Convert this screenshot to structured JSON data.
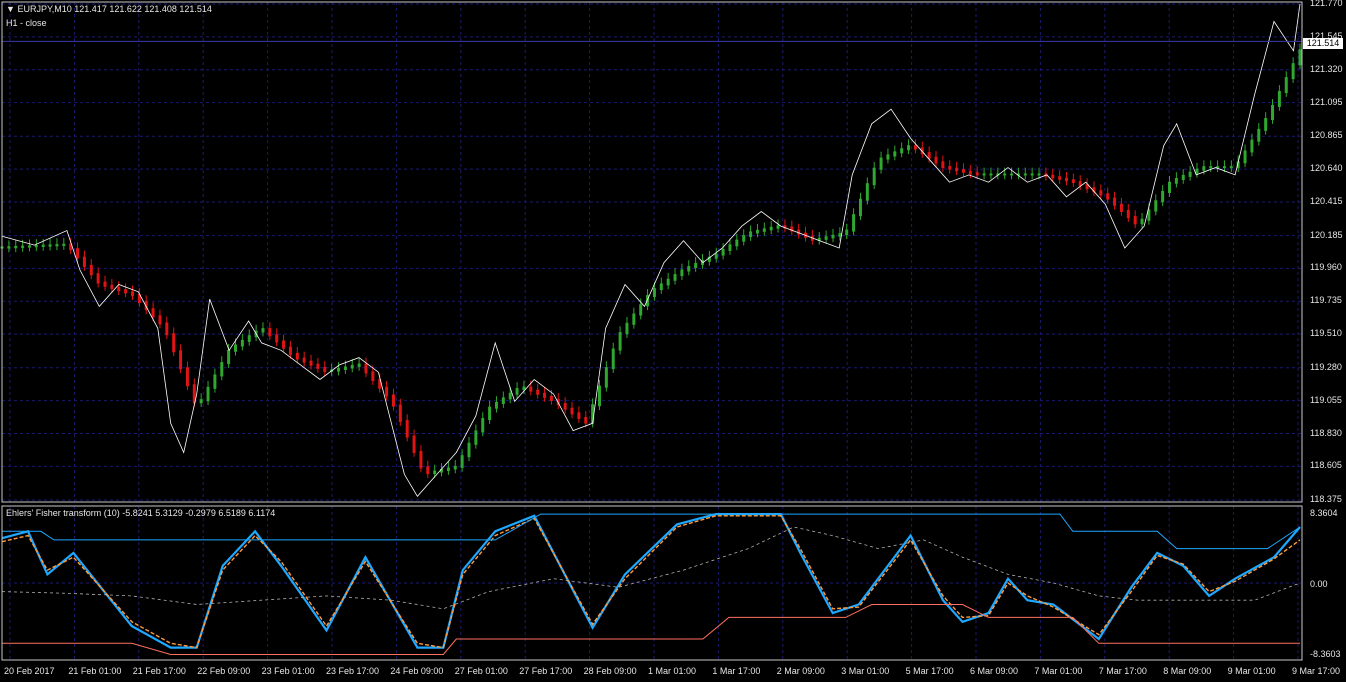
{
  "header": {
    "symbol_line": "EURJPY,M10  121.417 121.622 121.408 121.514",
    "overlay_label": "H1 - close"
  },
  "indicator": {
    "title": "Ehlers' Fisher transform (10) -5.8241 5.3129 -0.2979 6.5189 6.1174",
    "axis": {
      "top": "8.3604",
      "zero": "0.00",
      "bottom": "-8.3603"
    }
  },
  "current_price": "121.514",
  "colors": {
    "background": "#000000",
    "grid": "#1a1a6e",
    "up_bar": "#2ea82e",
    "down_bar": "#e01414",
    "close_line": "#ffffff",
    "fisher": "#1ea8ff",
    "signal": "#ff9a3c",
    "dashed": "#b0b0b0",
    "upper_band": "#1ea8ff",
    "lower_band": "#ff7060"
  },
  "chart_data": [
    {
      "type": "line",
      "title": "EURJPY,M10",
      "y_ticks": [
        "121.770",
        "121.545",
        "121.320",
        "121.095",
        "120.865",
        "120.640",
        "120.415",
        "120.185",
        "119.960",
        "119.735",
        "119.510",
        "119.280",
        "119.055",
        "118.830",
        "118.605",
        "118.375"
      ],
      "ylim": [
        118.375,
        121.77
      ],
      "x_ticks": [
        "20 Feb 2017",
        "21 Feb 01:00",
        "21 Feb 17:00",
        "22 Feb 09:00",
        "23 Feb 01:00",
        "23 Feb 17:00",
        "24 Feb 09:00",
        "27 Feb 01:00",
        "27 Feb 17:00",
        "28 Feb 09:00",
        "1 Mar 01:00",
        "1 Mar 17:00",
        "2 Mar 09:00",
        "3 Mar 01:00",
        "5 Mar 17:00",
        "6 Mar 09:00",
        "7 Mar 01:00",
        "7 Mar 17:00",
        "8 Mar 09:00",
        "9 Mar 01:00",
        "9 Mar 17:00"
      ],
      "series": [
        {
          "name": "H1 - close",
          "points": [
            [
              0,
              120.18
            ],
            [
              0.5,
              120.12
            ],
            [
              1,
              120.22
            ],
            [
              1.2,
              119.95
            ],
            [
              1.5,
              119.7
            ],
            [
              1.8,
              119.85
            ],
            [
              2.1,
              119.8
            ],
            [
              2.4,
              119.55
            ],
            [
              2.6,
              118.9
            ],
            [
              2.8,
              118.7
            ],
            [
              3.0,
              119.1
            ],
            [
              3.2,
              119.75
            ],
            [
              3.5,
              119.4
            ],
            [
              3.8,
              119.6
            ],
            [
              4.0,
              119.45
            ],
            [
              4.3,
              119.4
            ],
            [
              4.6,
              119.3
            ],
            [
              4.9,
              119.2
            ],
            [
              5.2,
              119.3
            ],
            [
              5.5,
              119.35
            ],
            [
              5.8,
              119.25
            ],
            [
              6.0,
              118.9
            ],
            [
              6.2,
              118.55
            ],
            [
              6.4,
              118.4
            ],
            [
              6.7,
              118.55
            ],
            [
              7.0,
              118.7
            ],
            [
              7.3,
              118.95
            ],
            [
              7.6,
              119.45
            ],
            [
              7.9,
              119.05
            ],
            [
              8.2,
              119.2
            ],
            [
              8.5,
              119.1
            ],
            [
              8.8,
              118.85
            ],
            [
              9.1,
              118.9
            ],
            [
              9.3,
              119.55
            ],
            [
              9.6,
              119.85
            ],
            [
              9.9,
              119.7
            ],
            [
              10.2,
              120.0
            ],
            [
              10.5,
              120.15
            ],
            [
              10.8,
              120.0
            ],
            [
              11.1,
              120.1
            ],
            [
              11.4,
              120.25
            ],
            [
              11.7,
              120.35
            ],
            [
              12.0,
              120.25
            ],
            [
              12.3,
              120.2
            ],
            [
              12.6,
              120.15
            ],
            [
              12.9,
              120.1
            ],
            [
              13.1,
              120.6
            ],
            [
              13.4,
              120.95
            ],
            [
              13.7,
              121.05
            ],
            [
              14.0,
              120.85
            ],
            [
              14.3,
              120.7
            ],
            [
              14.6,
              120.55
            ],
            [
              14.9,
              120.6
            ],
            [
              15.2,
              120.55
            ],
            [
              15.5,
              120.65
            ],
            [
              15.8,
              120.55
            ],
            [
              16.1,
              120.6
            ],
            [
              16.4,
              120.45
            ],
            [
              16.7,
              120.55
            ],
            [
              17.0,
              120.4
            ],
            [
              17.3,
              120.1
            ],
            [
              17.6,
              120.25
            ],
            [
              17.9,
              120.8
            ],
            [
              18.1,
              120.95
            ],
            [
              18.4,
              120.6
            ],
            [
              18.7,
              120.65
            ],
            [
              19.0,
              120.6
            ],
            [
              19.3,
              121.15
            ],
            [
              19.6,
              121.65
            ],
            [
              19.9,
              121.45
            ],
            [
              20.0,
              121.77
            ]
          ]
        },
        {
          "name": "",
          "points": [
            [
              0,
              120.1
            ],
            [
              1,
              120.12
            ],
            [
              1.5,
              119.85
            ],
            [
              2,
              119.78
            ],
            [
              2.5,
              119.55
            ],
            [
              3,
              119.0
            ],
            [
              3.5,
              119.4
            ],
            [
              4,
              119.55
            ],
            [
              4.5,
              119.35
            ],
            [
              5,
              119.25
            ],
            [
              5.5,
              119.3
            ],
            [
              6,
              119.05
            ],
            [
              6.5,
              118.55
            ],
            [
              7,
              118.6
            ],
            [
              7.5,
              119.0
            ],
            [
              8,
              119.15
            ],
            [
              8.5,
              119.05
            ],
            [
              9,
              118.9
            ],
            [
              9.5,
              119.5
            ],
            [
              10,
              119.8
            ],
            [
              10.5,
              119.95
            ],
            [
              11,
              120.05
            ],
            [
              11.5,
              120.2
            ],
            [
              12,
              120.25
            ],
            [
              12.5,
              120.15
            ],
            [
              13,
              120.2
            ],
            [
              13.5,
              120.7
            ],
            [
              14,
              120.8
            ],
            [
              14.5,
              120.65
            ],
            [
              15,
              120.6
            ],
            [
              15.5,
              120.6
            ],
            [
              16,
              120.6
            ],
            [
              16.5,
              120.55
            ],
            [
              17,
              120.45
            ],
            [
              17.5,
              120.25
            ],
            [
              18,
              120.55
            ],
            [
              18.5,
              120.65
            ],
            [
              19,
              120.65
            ],
            [
              19.5,
              121.0
            ],
            [
              20,
              121.45
            ]
          ]
        }
      ]
    },
    {
      "type": "line",
      "title": "Ehlers' Fisher transform (10) -5.8241 5.3129 -0.2979 6.5189 6.1174",
      "ylim": [
        -8.3603,
        8.3604
      ],
      "series": [
        {
          "name": "",
          "points": [
            [
              0,
              5.2
            ],
            [
              0.4,
              6.0
            ],
            [
              0.7,
              1.0
            ],
            [
              1.1,
              3.5
            ],
            [
              2.0,
              -5.0
            ],
            [
              2.6,
              -7.5
            ],
            [
              3.0,
              -7.5
            ],
            [
              3.4,
              2.0
            ],
            [
              3.9,
              6.0
            ],
            [
              4.3,
              2.0
            ],
            [
              5.0,
              -5.5
            ],
            [
              5.6,
              3.0
            ],
            [
              6.4,
              -7.5
            ],
            [
              6.8,
              -7.5
            ],
            [
              7.1,
              1.5
            ],
            [
              7.6,
              6.0
            ],
            [
              8.2,
              7.8
            ],
            [
              9.1,
              -5.2
            ],
            [
              9.6,
              1.0
            ],
            [
              10.4,
              6.8
            ],
            [
              11.0,
              8.0
            ],
            [
              12.0,
              8.0
            ],
            [
              12.3,
              3.5
            ],
            [
              12.8,
              -3.5
            ],
            [
              13.2,
              -2.5
            ],
            [
              14.0,
              5.5
            ],
            [
              14.5,
              -2.0
            ],
            [
              14.8,
              -4.5
            ],
            [
              15.2,
              -3.5
            ],
            [
              15.5,
              0.5
            ],
            [
              15.8,
              -2.0
            ],
            [
              16.2,
              -2.5
            ],
            [
              16.9,
              -6.5
            ],
            [
              17.4,
              -0.5
            ],
            [
              17.8,
              3.5
            ],
            [
              18.2,
              2.0
            ],
            [
              18.6,
              -1.5
            ],
            [
              19.0,
              0.5
            ],
            [
              19.6,
              3.0
            ],
            [
              20.0,
              6.5
            ]
          ]
        },
        {
          "name": "",
          "points": [
            [
              0,
              4.8
            ],
            [
              0.4,
              5.5
            ],
            [
              0.7,
              1.5
            ],
            [
              1.1,
              3.0
            ],
            [
              2.0,
              -4.5
            ],
            [
              2.6,
              -7.0
            ],
            [
              3.0,
              -7.5
            ],
            [
              3.4,
              1.5
            ],
            [
              3.9,
              5.5
            ],
            [
              4.3,
              2.5
            ],
            [
              5.0,
              -5.0
            ],
            [
              5.6,
              2.5
            ],
            [
              6.4,
              -7.0
            ],
            [
              6.8,
              -7.5
            ],
            [
              7.1,
              1.0
            ],
            [
              7.6,
              5.5
            ],
            [
              8.2,
              7.5
            ],
            [
              9.1,
              -4.8
            ],
            [
              9.6,
              0.5
            ],
            [
              10.4,
              6.5
            ],
            [
              11.0,
              7.8
            ],
            [
              12.0,
              7.8
            ],
            [
              12.3,
              4.0
            ],
            [
              12.8,
              -3.0
            ],
            [
              13.2,
              -2.8
            ],
            [
              14.0,
              5.0
            ],
            [
              14.5,
              -1.5
            ],
            [
              14.8,
              -4.0
            ],
            [
              15.2,
              -3.8
            ],
            [
              15.5,
              0.0
            ],
            [
              15.8,
              -1.5
            ],
            [
              16.2,
              -2.8
            ],
            [
              16.9,
              -6.0
            ],
            [
              17.4,
              -1.0
            ],
            [
              17.8,
              3.2
            ],
            [
              18.2,
              2.2
            ],
            [
              18.6,
              -1.0
            ],
            [
              19.0,
              0.2
            ],
            [
              19.6,
              2.8
            ],
            [
              20.0,
              5.0
            ]
          ]
        },
        {
          "name": "",
          "points": [
            [
              0,
              -1.0
            ],
            [
              1.0,
              -1.2
            ],
            [
              2.0,
              -1.5
            ],
            [
              3.0,
              -2.5
            ],
            [
              4.0,
              -2.0
            ],
            [
              5.0,
              -1.5
            ],
            [
              6.0,
              -2.0
            ],
            [
              6.8,
              -3.0
            ],
            [
              7.5,
              -1.0
            ],
            [
              8.5,
              0.5
            ],
            [
              9.5,
              -0.5
            ],
            [
              10.5,
              1.5
            ],
            [
              11.5,
              4.0
            ],
            [
              12.2,
              6.5
            ],
            [
              12.8,
              5.5
            ],
            [
              13.5,
              4.0
            ],
            [
              14.2,
              5.0
            ],
            [
              14.8,
              3.0
            ],
            [
              15.5,
              1.0
            ],
            [
              16.2,
              0.0
            ],
            [
              16.9,
              -1.5
            ],
            [
              17.5,
              -2.0
            ],
            [
              18.5,
              -2.0
            ],
            [
              19.3,
              -2.0
            ],
            [
              20.0,
              0.0
            ]
          ]
        },
        {
          "name": "",
          "points": [
            [
              0,
              6.0
            ],
            [
              0.6,
              6.0
            ],
            [
              0.8,
              5.0
            ],
            [
              7.6,
              5.0
            ],
            [
              8.3,
              8.0
            ],
            [
              16.3,
              8.0
            ],
            [
              16.5,
              6.0
            ],
            [
              17.8,
              6.0
            ],
            [
              18.1,
              4.0
            ],
            [
              19.5,
              4.0
            ],
            [
              20.0,
              6.5
            ]
          ]
        },
        {
          "name": "",
          "points": [
            [
              0,
              -7.0
            ],
            [
              2.0,
              -7.0
            ],
            [
              2.6,
              -8.3
            ],
            [
              6.8,
              -8.3
            ],
            [
              7.0,
              -6.5
            ],
            [
              10.8,
              -6.5
            ],
            [
              11.2,
              -4.0
            ],
            [
              13.0,
              -4.0
            ],
            [
              13.4,
              -2.5
            ],
            [
              14.8,
              -2.5
            ],
            [
              15.2,
              -4.0
            ],
            [
              16.5,
              -4.0
            ],
            [
              16.9,
              -7.0
            ],
            [
              20.0,
              -7.0
            ]
          ]
        }
      ]
    }
  ]
}
